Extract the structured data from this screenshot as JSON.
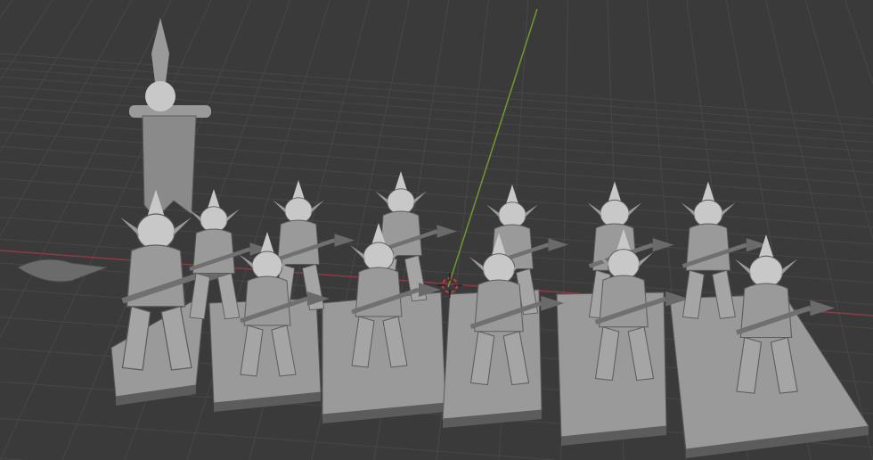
{
  "viewport": {
    "background": "#3a3a3a",
    "grid_color": "#474747",
    "x_axis_color": "#8e3a44",
    "y_axis_color": "#6f9a2c",
    "cursor_color": "#d23a3a",
    "model_color": "#9a9a9a",
    "model_shadow": "#5c5c5c",
    "model_highlight": "#c8c8c8"
  }
}
